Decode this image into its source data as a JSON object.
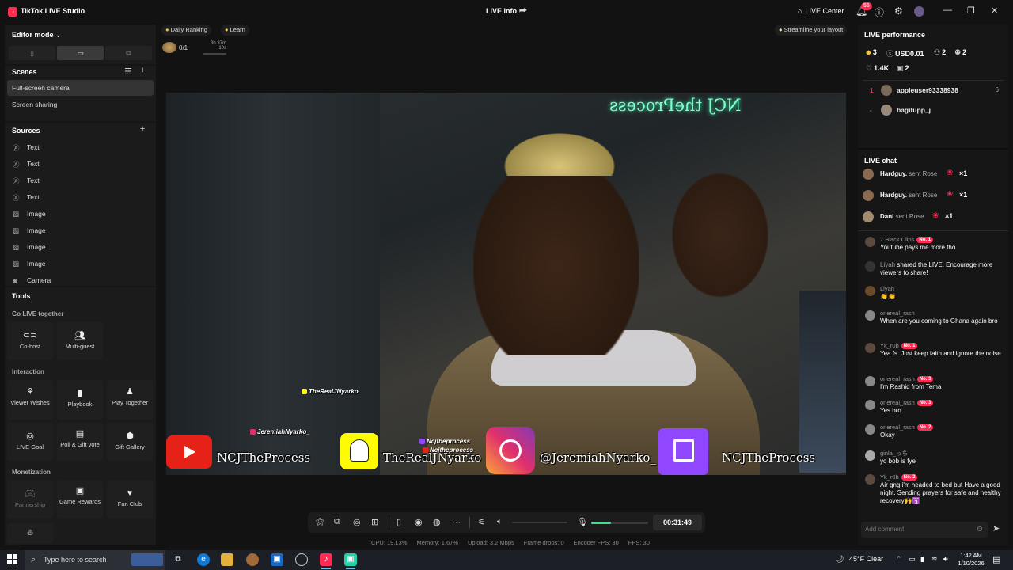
{
  "app": {
    "title": "TikTok LIVE Studio",
    "window_title": "LIVE info",
    "live_center": "LIVE Center",
    "notification_count": "55",
    "logo_glyph": "♪"
  },
  "left": {
    "editor_mode": "Editor mode",
    "scenes_title": "Scenes",
    "scenes": [
      "Full-screen camera",
      "Screen sharing"
    ],
    "sources_title": "Sources",
    "sources": [
      {
        "icon": "text-icon",
        "label": "Text"
      },
      {
        "icon": "text-icon",
        "label": "Text"
      },
      {
        "icon": "text-icon",
        "label": "Text"
      },
      {
        "icon": "text-icon",
        "label": "Text"
      },
      {
        "icon": "image-icon",
        "label": "Image"
      },
      {
        "icon": "image-icon",
        "label": "Image"
      },
      {
        "icon": "image-icon",
        "label": "Image"
      },
      {
        "icon": "image-icon",
        "label": "Image"
      },
      {
        "icon": "camera-icon",
        "label": "Camera"
      }
    ],
    "tools_title": "Tools",
    "go_live_together": "Go LIVE together",
    "interaction": "Interaction",
    "monetization": "Monetization",
    "tools": {
      "cohost": "Co-host",
      "multiguest": "Multi-guest",
      "viewer_wishes": "Viewer Wishes",
      "playbook": "Playbook",
      "play_together": "Play Together",
      "live_goal": "LIVE Goal",
      "poll_gift_vote": "Poll & Gift vote",
      "gift_gallery": "Gift Gallery",
      "partnership": "Partnership",
      "game_rewards": "Game Rewards",
      "fan_club": "Fan Club"
    }
  },
  "top": {
    "daily_ranking": "Daily Ranking",
    "learn": "Learn",
    "streamline": "Streamline your layout",
    "rank_progress": "0/1",
    "rank_timer": "3h 37m 10s",
    "rank_progress_fraction": 0
  },
  "video": {
    "neon_text": "NCJ theProcess",
    "overlay_handle_top": "TheRealJNyarko",
    "overlay_jeremiah_small": "JeremiahNyarko_",
    "overlay_youtube": "NCJTheProcess",
    "overlay_snapchat": "TheRealJNyarko",
    "overlay_instagram": "@JeremiahNyarko_",
    "overlay_twitch": "NCJTheProcess",
    "overlay_small_1": "Ncjtheprocess",
    "overlay_small_2": "Ncjtheprocess"
  },
  "controls": {
    "timer": "00:31:49",
    "mic_level": 0.35,
    "stats": {
      "cpu": "CPU: 19.13%",
      "memory": "Memory: 1.67%",
      "upload": "Upload: 3.2 Mbps",
      "frame_drops": "Frame drops: 0",
      "encoder_fps": "Encoder FPS: 30",
      "fps": "FPS: 30"
    }
  },
  "right": {
    "performance_title": "LIVE performance",
    "stats": {
      "diamonds": "3",
      "usd": "USD0.01",
      "viewers": "2",
      "new_followers": "2",
      "likes": "1.4K",
      "gifters": "2"
    },
    "top_viewers": [
      {
        "rank": "1",
        "name": "appleuser93338938",
        "score": "6"
      },
      {
        "rank": "-",
        "name": "bagitupp_j",
        "score": ""
      }
    ],
    "chat_title": "LIVE chat",
    "gifts": [
      {
        "name": "Hardguy.",
        "text": "sent Rose",
        "count": "×1"
      },
      {
        "name": "Hardguy.",
        "text": "sent Rose",
        "count": "×1"
      },
      {
        "name": "Dani",
        "text": "sent Rose",
        "count": "×1"
      }
    ],
    "messages": [
      {
        "user": "7 Black Clips",
        "level": "No. 1",
        "text": "Youtube pays me more tho"
      },
      {
        "user": "Liyah",
        "level": "",
        "text": "shared the LIVE. Encourage more viewers to share!"
      },
      {
        "user": "Liyah",
        "level": "",
        "text": "👏👏"
      },
      {
        "user": "onereal_rash",
        "level": "",
        "text": "When are you coming to Ghana again bro"
      },
      {
        "user": "Yk_r0b",
        "level": "No. 1",
        "text": "Yea fs. Just keep faith and ignore the noise"
      },
      {
        "user": "onereal_rash",
        "level": "No. 3",
        "text": "I'm Rashid from Tema"
      },
      {
        "user": "onereal_rash",
        "level": "No. 3",
        "text": "Yes bro"
      },
      {
        "user": "onereal_rash",
        "level": "No. 2",
        "text": "Okay"
      },
      {
        "user": "ginla_っち",
        "level": "",
        "text": "yo bob is fye"
      },
      {
        "user": "Yk_r0b",
        "level": "No. 2",
        "text": "Air gng i'm headed to bed but Have a good night. Sending prayers for safe and healthy recovery🙌🛐"
      }
    ],
    "comment_placeholder": "Add comment"
  },
  "taskbar": {
    "search_placeholder": "Type here to search",
    "weather": "45°F  Clear",
    "time": "1:42 AM",
    "date": "1/10/2026"
  },
  "colors": {
    "accent": "#fe2c55",
    "mic_green": "#3fe08d",
    "background": "#121212"
  }
}
